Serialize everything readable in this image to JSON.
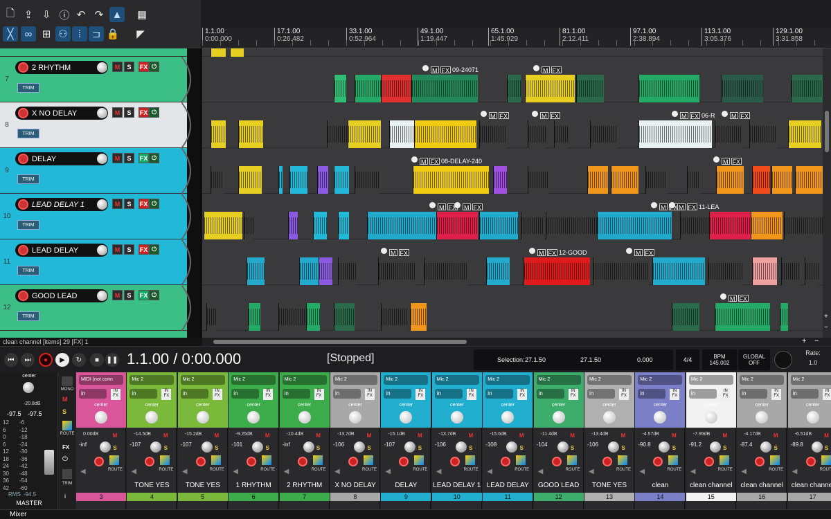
{
  "ruler": {
    "markers": [
      {
        "bar": "1.1.00",
        "time": "0:00.000"
      },
      {
        "bar": "17.1.00",
        "time": "0:26.482"
      },
      {
        "bar": "33.1.00",
        "time": "0:52.964"
      },
      {
        "bar": "49.1.00",
        "time": "1:19.447"
      },
      {
        "bar": "65.1.00",
        "time": "1:45.929"
      },
      {
        "bar": "81.1.00",
        "time": "2:12.411"
      },
      {
        "bar": "97.1.00",
        "time": "2:38.894"
      },
      {
        "bar": "113.1.00",
        "time": "3:05.376"
      },
      {
        "bar": "129.1.00",
        "time": "3:31.858"
      }
    ]
  },
  "tracks": [
    {
      "num": "7",
      "name": "2 RHYTHM",
      "color": "#3cbf86",
      "italic": false,
      "trim": "TRIM"
    },
    {
      "num": "8",
      "name": "X NO DELAY",
      "color": "#e2e6e8",
      "italic": false,
      "trim": "TRIM"
    },
    {
      "num": "9",
      "name": "DELAY",
      "color": "#22b9d8",
      "italic": false,
      "trim": "TRIM"
    },
    {
      "num": "10",
      "name": "LEAD DELAY 1",
      "color": "#22b9d8",
      "italic": true,
      "trim": "TRIM"
    },
    {
      "num": "11",
      "name": "LEAD DELAY",
      "color": "#22b9d8",
      "italic": false,
      "trim": "TRIM"
    },
    {
      "num": "12",
      "name": "GOOD LEAD",
      "color": "#3cbf86",
      "italic": false,
      "trim": "TRIM"
    }
  ],
  "clip_labels": {
    "lane0": "09-24071",
    "lane1": "06-R",
    "lane2": "08-DELAY-240",
    "lane3": "11-LEA",
    "lane4": "12-GOOD"
  },
  "status_bar": "clean channel [items] 29 [FX] 1",
  "transport": {
    "timecode": "1.1.00 / 0:00.000",
    "state": "[Stopped]",
    "selection_label": "Selection:",
    "selection_start": "27.1.50",
    "selection_end": "27.1.50",
    "selection_length": "0.000",
    "time_sig": "4/4",
    "bpm_label": "BPM",
    "bpm": "145.002",
    "global_label": "GLOBAL",
    "global_state": "OFF",
    "rate_label": "Rate:",
    "rate": "1.0"
  },
  "master": {
    "pan": "center",
    "peak": "-20.8dB",
    "left": "-97.5",
    "right": "-97.5",
    "rms_label": "RMS",
    "rms": "-94.5",
    "name": "MASTER",
    "scale": [
      "12",
      "6",
      "0",
      "6",
      "12",
      "18",
      "24",
      "30",
      "36",
      "42"
    ],
    "scale2": [
      "-6",
      "-12",
      "-18",
      "-24",
      "-30",
      "-36",
      "-42",
      "-48",
      "-54",
      "-60"
    ]
  },
  "mixer_side": {
    "mono": "MONO",
    "route": "ROUTE",
    "trim": "TRIM"
  },
  "strips": [
    {
      "input": "MIDI (not conn",
      "route": "in",
      "pan": "center",
      "gain": "0.00dB",
      "vol": "-inf",
      "name": "",
      "num": "3",
      "color": "#d9569b",
      "numcolor": "#d9569b"
    },
    {
      "input": "Mic 2",
      "route": "in",
      "pan": "center",
      "gain": "-14.5dB",
      "vol": "-107",
      "name": "TONE YES",
      "num": "4",
      "color": "#7ab93a",
      "numcolor": "#7ab93a"
    },
    {
      "input": "Mic 2",
      "route": "in",
      "pan": "center",
      "gain": "-15.2dB",
      "vol": "-107",
      "name": "TONE YES",
      "num": "5",
      "color": "#7ab93a",
      "numcolor": "#7ab93a"
    },
    {
      "input": "Mic 2",
      "route": "in",
      "pan": "center",
      "gain": "-9.25dB",
      "vol": "-101",
      "name": "1 RHYTHM",
      "num": "6",
      "color": "#3cad4a",
      "numcolor": "#3cad4a"
    },
    {
      "input": "Mic 2",
      "route": "in",
      "pan": "center",
      "gain": "-10.4dB",
      "vol": "-inf",
      "name": "2 RHYTHM",
      "num": "7",
      "color": "#3cad4a",
      "numcolor": "#3cad4a"
    },
    {
      "input": "Mic 2",
      "route": "in",
      "pan": "center",
      "gain": "-13.7dB",
      "vol": "-106",
      "name": "X NO DELAY",
      "num": "8",
      "color": "#a8a8a8",
      "numcolor": "#a8a8a8"
    },
    {
      "input": "Mic 2",
      "route": "in",
      "pan": "center",
      "gain": "-15.1dB",
      "vol": "-107",
      "name": "DELAY",
      "num": "9",
      "color": "#22aecf",
      "numcolor": "#22aecf"
    },
    {
      "input": "Mic 2",
      "route": "in",
      "pan": "center",
      "gain": "-13.7dB",
      "vol": "-106",
      "name": "LEAD DELAY 1",
      "num": "10",
      "color": "#22aecf",
      "numcolor": "#22aecf"
    },
    {
      "input": "Mic 2",
      "route": "in",
      "pan": "center",
      "gain": "-15.6dB",
      "vol": "-108",
      "name": "LEAD DELAY",
      "num": "11",
      "color": "#22aecf",
      "numcolor": "#22aecf"
    },
    {
      "input": "Mic 2",
      "route": "in",
      "pan": "center",
      "gain": "-11.4dB",
      "vol": "-104",
      "name": "GOOD LEAD",
      "num": "12",
      "color": "#3cad6a",
      "numcolor": "#3cad6a"
    },
    {
      "input": "Mic 2",
      "route": "in",
      "pan": "center",
      "gain": "-13.4dB",
      "vol": "-106",
      "name": "TONE YES",
      "num": "13",
      "color": "#b0b0b0",
      "numcolor": "#b0b0b0"
    },
    {
      "input": "Mic 2",
      "route": "in",
      "pan": "center",
      "gain": "-4.57dB",
      "vol": "-90.8",
      "name": "clean",
      "num": "14",
      "color": "#7a7fc8",
      "numcolor": "#7a7fc8"
    },
    {
      "input": "Mic 2",
      "route": "in",
      "pan": "center",
      "gain": "-7.99dB",
      "vol": "-91.2",
      "name": "clean channel",
      "num": "15",
      "color": "#f2f2f2",
      "numcolor": "#f2f2f2"
    },
    {
      "input": "Mic 2",
      "route": "in",
      "pan": "center",
      "gain": "-4.17dB",
      "vol": "-87.4",
      "name": "clean channel",
      "num": "16",
      "color": "#a8a8a8",
      "numcolor": "#a8a8a8"
    },
    {
      "input": "Mic 2",
      "route": "in",
      "pan": "center",
      "gain": "-6.51dB",
      "vol": "-89.8",
      "name": "clean channel",
      "num": "17",
      "color": "#a8a8a8",
      "numcolor": "#a8a8a8"
    }
  ],
  "mixer_tab": "Mixer",
  "colors": {
    "accent": "#1d4f7a",
    "record": "#d22",
    "mute": "#e33",
    "solo": "#ec4"
  },
  "icons": [
    "new-file-icon",
    "open-icon",
    "save-icon",
    "info-icon",
    "undo-icon",
    "redo-icon",
    "metronome-icon",
    "grid-icon",
    "ripple-icon",
    "link-icon",
    "snap-icon",
    "lock-icon",
    "play-icon",
    "stop-icon",
    "pause-icon",
    "record-icon",
    "loop-icon"
  ]
}
